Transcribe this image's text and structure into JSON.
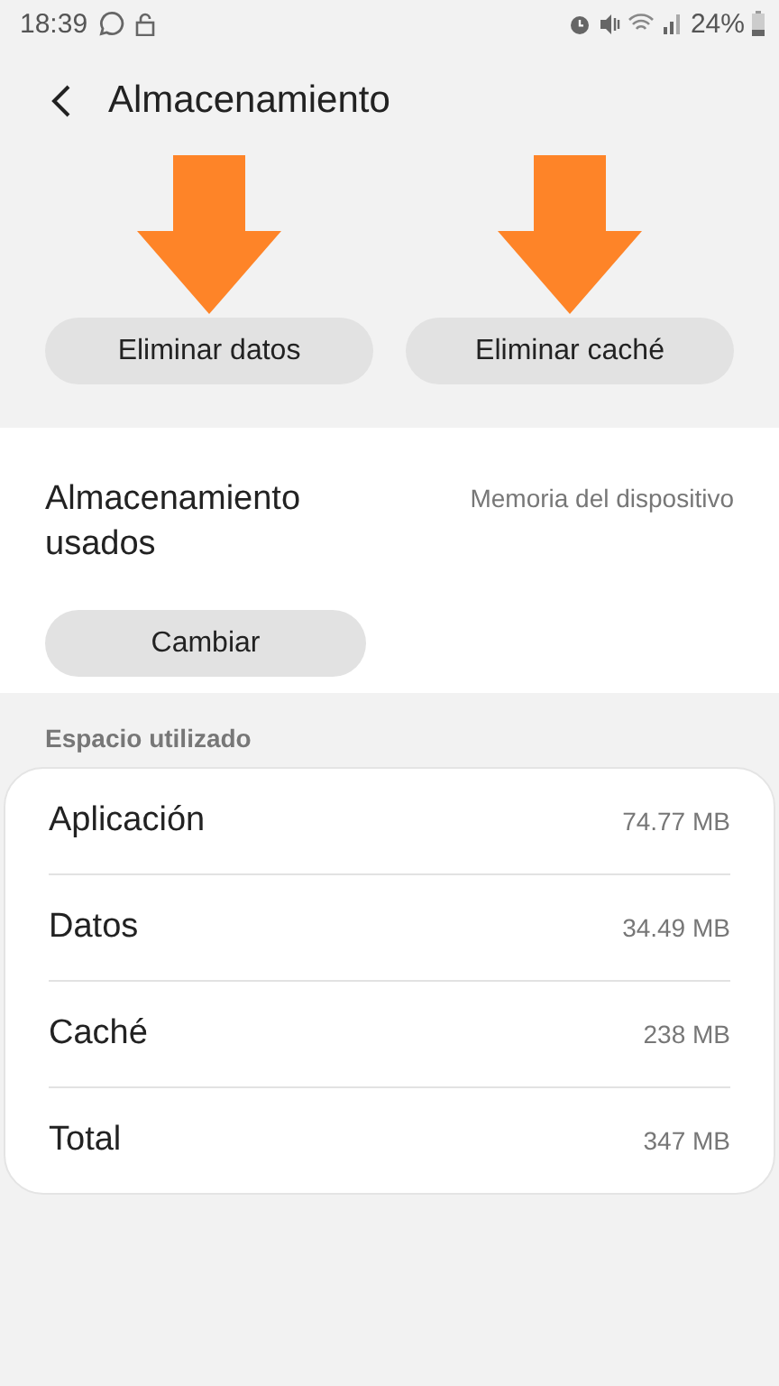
{
  "status_bar": {
    "time": "18:39",
    "battery": "24%"
  },
  "header": {
    "title": "Almacenamiento"
  },
  "actions": [
    {
      "label": "Eliminar datos",
      "highlighted": true
    },
    {
      "label": "Eliminar caché",
      "highlighted": true
    }
  ],
  "storage": {
    "label": "Almacenamiento usados",
    "location": "Memoria del dispositivo",
    "button": "Cambiar"
  },
  "usage": {
    "heading": "Espacio utilizado",
    "rows": [
      {
        "name": "Aplicación",
        "size": "74.77 MB"
      },
      {
        "name": "Datos",
        "size": "34.49 MB"
      },
      {
        "name": "Caché",
        "size": "238 MB"
      },
      {
        "name": "Total",
        "size": "347 MB"
      }
    ]
  }
}
